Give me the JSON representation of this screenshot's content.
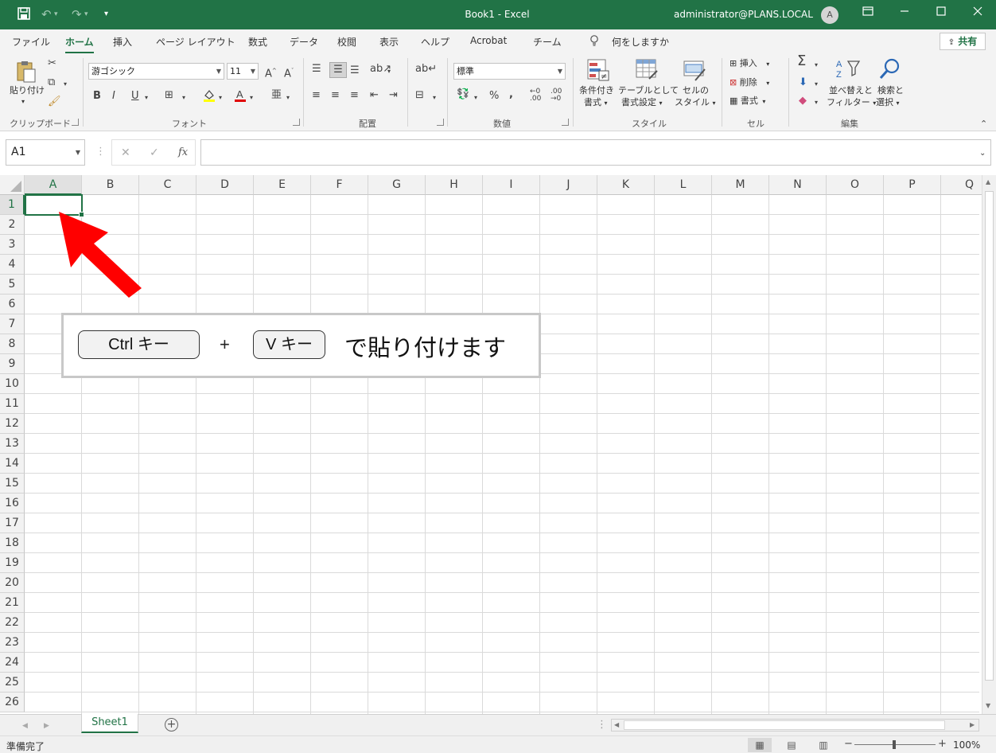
{
  "titlebar": {
    "doc_title": "Book1  -  Excel",
    "user": "administrator@PLANS.LOCAL",
    "avatar_initial": "A",
    "save_icon": "💾",
    "undo_icon": "↶",
    "redo_icon": "↷",
    "customize_icon": "▾"
  },
  "tabs": [
    {
      "label": "ファイル"
    },
    {
      "label": "ホーム"
    },
    {
      "label": "挿入"
    },
    {
      "label": "ページ レイアウト"
    },
    {
      "label": "数式"
    },
    {
      "label": "データ"
    },
    {
      "label": "校閲"
    },
    {
      "label": "表示"
    },
    {
      "label": "ヘルプ"
    },
    {
      "label": "Acrobat"
    },
    {
      "label": "チーム"
    }
  ],
  "tell_me": "何をしますか",
  "share_label": "共有",
  "ribbon": {
    "clipboard": {
      "paste_label": "貼り付け",
      "group_label": "クリップボード"
    },
    "font": {
      "font_name": "游ゴシック",
      "font_size": "11",
      "group_label": "フォント"
    },
    "alignment": {
      "group_label": "配置"
    },
    "number": {
      "format": "標準",
      "group_label": "数値"
    },
    "styles": {
      "cond_format_l1": "条件付き",
      "cond_format_l2": "書式",
      "table_l1": "テーブルとして",
      "table_l2": "書式設定",
      "cell_style_l1": "セルの",
      "cell_style_l2": "スタイル",
      "group_label": "スタイル"
    },
    "cells": {
      "insert": "挿入",
      "delete": "削除",
      "format": "書式",
      "group_label": "セル"
    },
    "editing": {
      "sort_l1": "並べ替えと",
      "sort_l2": "フィルター",
      "find_l1": "検索と",
      "find_l2": "選択",
      "group_label": "編集"
    }
  },
  "formula_bar": {
    "name_box": "A1",
    "fx_label": "fx",
    "value": ""
  },
  "columns": [
    "A",
    "B",
    "C",
    "D",
    "E",
    "F",
    "G",
    "H",
    "I",
    "J",
    "K",
    "L",
    "M",
    "N",
    "O",
    "P",
    "Q"
  ],
  "rows": [
    "1",
    "2",
    "3",
    "4",
    "5",
    "6",
    "7",
    "8",
    "9",
    "10",
    "11",
    "12",
    "13",
    "14",
    "15",
    "16",
    "17",
    "18",
    "19",
    "20",
    "21",
    "22",
    "23",
    "24",
    "25",
    "26"
  ],
  "callout": {
    "key1": "Ctrl キー",
    "plus": "+",
    "key2": "V キー",
    "text": "で貼り付けます"
  },
  "sheets": [
    {
      "label": "Sheet1"
    }
  ],
  "status": {
    "text": "準備完了",
    "zoom": "100%"
  },
  "colors": {
    "accent": "#217346",
    "arrow": "#ff0000"
  }
}
